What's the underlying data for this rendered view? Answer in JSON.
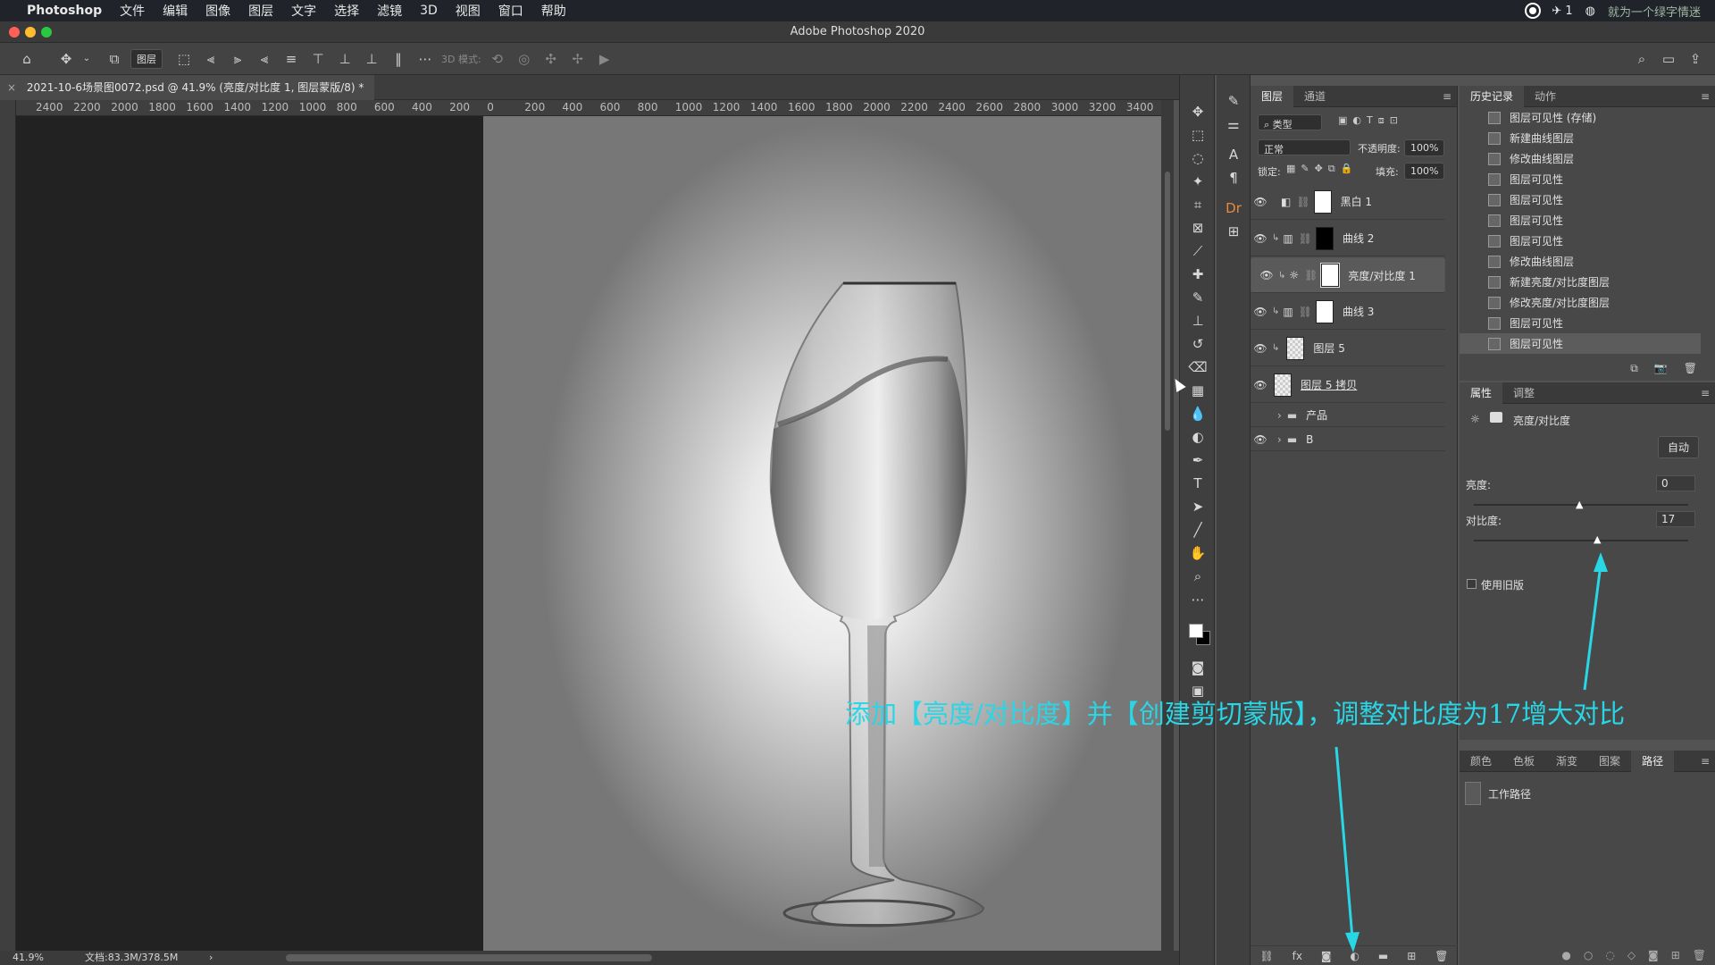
{
  "menubar": {
    "apple": "",
    "app": "Photoshop",
    "items": [
      "文件",
      "编辑",
      "图像",
      "图层",
      "文字",
      "选择",
      "滤镜",
      "3D",
      "视图",
      "窗口",
      "帮助"
    ],
    "right_notif": "1",
    "right_text": "就为一个绿字情迷"
  },
  "window": {
    "title": "Adobe Photoshop 2020"
  },
  "options": {
    "layer_select": "图层",
    "mode_3d": "3D 模式:"
  },
  "document": {
    "tab": "2021-10-6场景图0072.psd @ 41.9% (亮度/对比度 1, 图层蒙版/8) *",
    "close": "×"
  },
  "ruler": {
    "h_ticks": [
      "2400",
      "2200",
      "2000",
      "1800",
      "1600",
      "1400",
      "1200",
      "1000",
      "800",
      "600",
      "400",
      "200",
      "0",
      "200",
      "400",
      "600",
      "800",
      "1000",
      "1200",
      "1400",
      "1600",
      "1800",
      "2000",
      "2200",
      "2400",
      "2600",
      "2800",
      "3000",
      "3200",
      "3400"
    ]
  },
  "status": {
    "zoom": "41.9%",
    "doc": "文档:83.3M/378.5M",
    "arrow": "›"
  },
  "layers_panel": {
    "tabs": [
      "图层",
      "通道"
    ],
    "filter": "类型",
    "blend": "正常",
    "opacity_label": "不透明度:",
    "opacity": "100%",
    "lock_label": "锁定:",
    "fill_label": "填充:",
    "fill": "100%",
    "layers": [
      {
        "name": "黑白 1",
        "thumb": "#ffffff",
        "visible": "👁"
      },
      {
        "name": "曲线 2",
        "thumb": "#000000",
        "visible": "👁"
      },
      {
        "name": "亮度/对比度 1",
        "thumb": "#ffffff",
        "visible": "👁"
      },
      {
        "name": "曲线 3",
        "thumb": "#ffffff",
        "visible": "👁"
      },
      {
        "name": "图层 5",
        "thumb": "#d0d0d0",
        "visible": "👁"
      },
      {
        "name": "图层 5 拷贝",
        "thumb": "#dcdcdc",
        "visible": "👁"
      },
      {
        "name": "产品",
        "thumb": "",
        "visible": ""
      },
      {
        "name": "B",
        "thumb": "",
        "visible": "👁"
      }
    ]
  },
  "history_panel": {
    "tabs": [
      "历史记录",
      "动作"
    ],
    "items": [
      "图层可见性 (存储)",
      "新建曲线图层",
      "修改曲线图层",
      "图层可见性",
      "图层可见性",
      "图层可见性",
      "图层可见性",
      "修改曲线图层",
      "新建亮度/对比度图层",
      "修改亮度/对比度图层",
      "图层可见性",
      "图层可见性"
    ]
  },
  "properties_panel": {
    "tabs": [
      "属性",
      "调整"
    ],
    "type": "亮度/对比度",
    "auto": "自动",
    "brightness_label": "亮度:",
    "brightness": "0",
    "contrast_label": "对比度:",
    "contrast": "17",
    "legacy": "使用旧版"
  },
  "paths_panel": {
    "tabs": [
      "颜色",
      "色板",
      "渐变",
      "图案",
      "路径"
    ],
    "item": "工作路径"
  },
  "caption": "添加【亮度/对比度】并【创建剪切蒙版】，调整对比度为17增大对比",
  "colors": {
    "accent": "#29d6e6",
    "panel": "#484848",
    "canvas_bg": "#222222"
  }
}
